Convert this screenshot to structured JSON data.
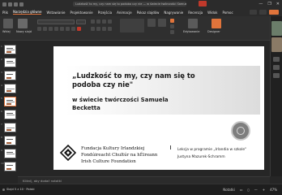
{
  "window": {
    "document_title": "Ludzkość to my, czy nam się to podoba czy nie — w świecie twórczości Samuela Becketta",
    "controls": [
      "—",
      "❐",
      "✕"
    ]
  },
  "menu": {
    "tabs": [
      "Plik",
      "Narzędzia główne",
      "Wstawianie",
      "Projektowanie",
      "Przejścia",
      "Animacje",
      "Pokaz slajdów",
      "Nagrywanie",
      "Recenzja",
      "Widok",
      "Pomoc"
    ],
    "active_index": 1
  },
  "ribbon": {
    "paste_label": "Wklej",
    "slide_label": "Nowy slajd",
    "font_name": "",
    "font_size": "",
    "editing_label": "Edytowanie",
    "designer_label": "Designer"
  },
  "thumbnails": {
    "numbers": [
      "1",
      "2",
      "3",
      "4",
      "5",
      "6",
      "7",
      "8",
      "9",
      "10"
    ],
    "selected_index": 4
  },
  "slide": {
    "title_line1": "„Ludzkość to my, czy nam się to",
    "title_line2": "podoba czy nie\"",
    "subtitle_line1": "w świecie twórczości Samuela",
    "subtitle_line2": "Becketta",
    "foundation_lines": [
      "Fundacja Kultury Irlandzkiej",
      "Fondúireacht Chultúr na hÉireann",
      "Irish Culture Foundation"
    ],
    "info_lines": [
      "Lekcja w programie „Irlandia w szkole\"",
      "Justyna Mazurek-Schramm"
    ]
  },
  "notes": {
    "placeholder": "Kliknij, aby dodać notatki"
  },
  "status": {
    "text": "Slajd 5 z 10 · Polski",
    "right": [
      "Notatki",
      "▭",
      "▯",
      "—",
      "+",
      "47%"
    ]
  },
  "colors": {
    "accent": "#e0743b"
  }
}
